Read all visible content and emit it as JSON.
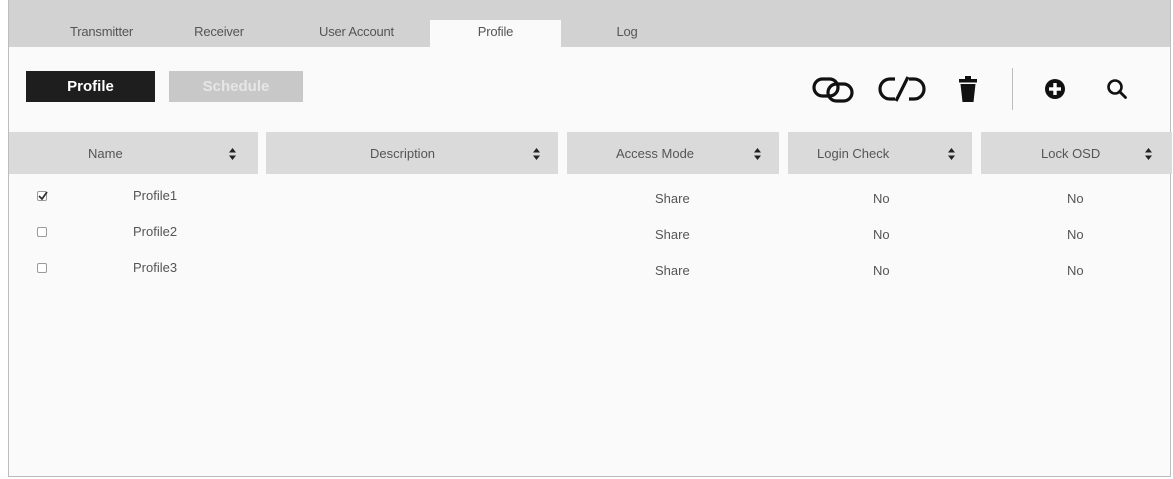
{
  "tabs": [
    {
      "label": "Transmitter",
      "active": false
    },
    {
      "label": "Receiver",
      "active": false
    },
    {
      "label": "User Account",
      "active": false
    },
    {
      "label": "Profile",
      "active": true
    },
    {
      "label": "Log",
      "active": false
    }
  ],
  "subtabs": {
    "profile_label": "Profile",
    "schedule_label": "Schedule",
    "active": "Profile"
  },
  "toolbar": {
    "icons": [
      "link-icon",
      "unlink-icon",
      "delete-icon",
      "add-icon",
      "search-icon"
    ]
  },
  "table": {
    "columns": [
      "Name",
      "Description",
      "Access Mode",
      "Login Check",
      "Lock OSD"
    ],
    "rows": [
      {
        "checked": true,
        "name": "Profile1",
        "description": "",
        "access_mode": "Share",
        "login_check": "No",
        "lock_osd": "No"
      },
      {
        "checked": false,
        "name": "Profile2",
        "description": "",
        "access_mode": "Share",
        "login_check": "No",
        "lock_osd": "No"
      },
      {
        "checked": false,
        "name": "Profile3",
        "description": "",
        "access_mode": "Share",
        "login_check": "No",
        "lock_osd": "No"
      }
    ]
  },
  "colors": {
    "tabbar_bg": "#d2d2d2",
    "header_bg": "#dadada",
    "active_button_bg": "#1e1e1e",
    "inactive_button_bg": "#c8c8c8"
  }
}
